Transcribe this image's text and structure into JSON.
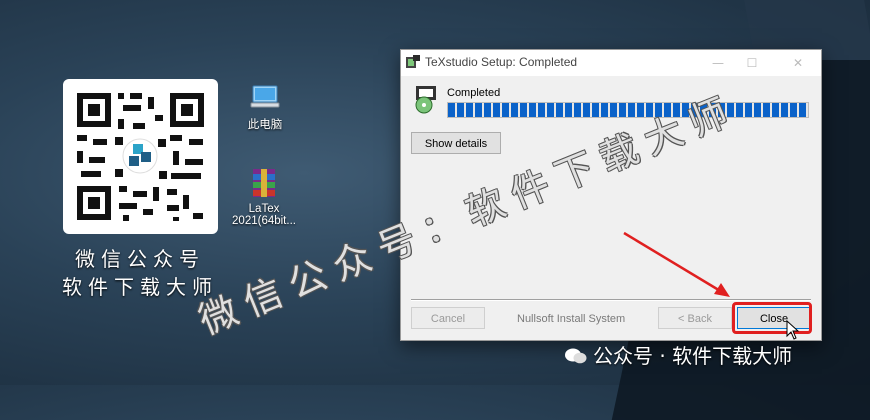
{
  "desktop": {
    "qr_caption_line1": "微信公众号",
    "qr_caption_line2": "软件下载大师",
    "icons": [
      {
        "label": "此电脑",
        "icon": "computer-icon"
      },
      {
        "label": "LaTex 2021(64bit...",
        "icon": "winrar-archive-icon"
      }
    ]
  },
  "window": {
    "title": "TeXstudio Setup: Completed",
    "controls": [
      "—",
      "☐",
      "✕"
    ],
    "status_label": "Completed",
    "progress_percent": 100,
    "show_details_label": "Show details",
    "footer_brand": "Nullsoft Install System",
    "buttons": {
      "cancel": "Cancel",
      "back": "< Back",
      "close": "Close"
    }
  },
  "watermark": {
    "overlay_text": "微信公众号：软件下载大师",
    "footer_text": "公众号 · 软件下载大师"
  },
  "colors": {
    "progress_blue": "#0a62c9",
    "highlight_red": "#e02020"
  }
}
